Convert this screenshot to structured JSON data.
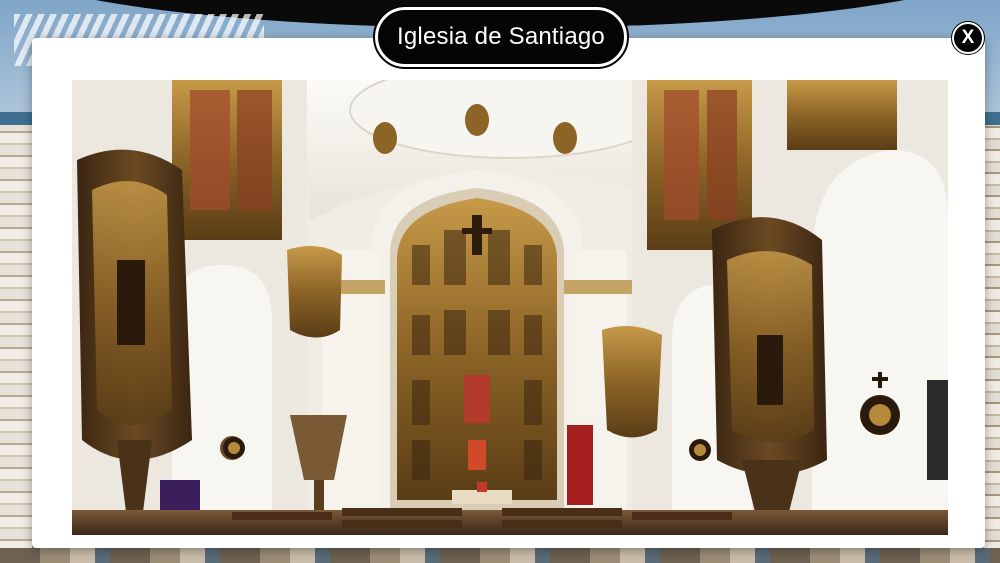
{
  "modal": {
    "title": "Iglesia de Santiago",
    "close_label": "X"
  },
  "photo": {
    "subject": "church-interior",
    "icon": "church-interior-photo"
  },
  "colors": {
    "pill_bg": "#050505",
    "pill_border": "#ffffff",
    "modal_bg": "#ffffff",
    "gold": "#b58a3c",
    "dark_wood": "#4a3218",
    "wall_white": "#f4f1ea"
  }
}
